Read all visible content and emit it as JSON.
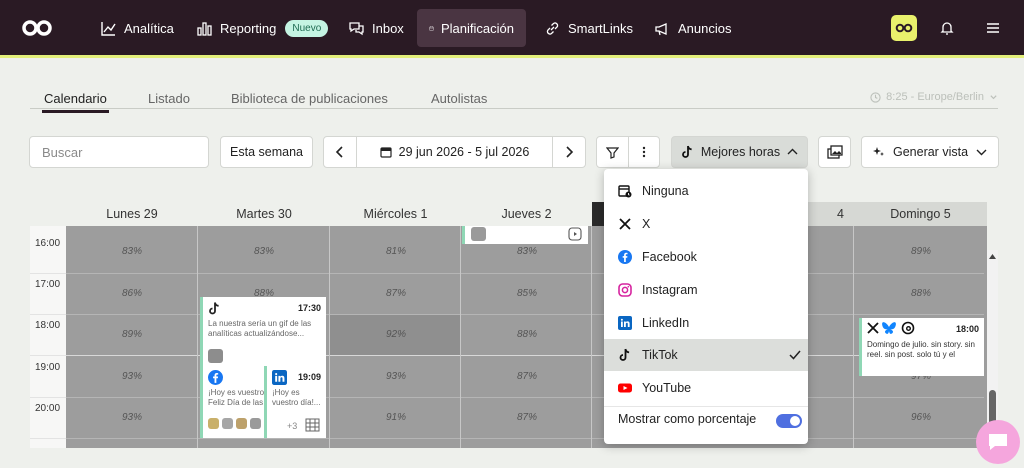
{
  "nav": {
    "items": [
      {
        "label": "Analítica",
        "icon": "chart-line-icon"
      },
      {
        "label": "Reporting",
        "icon": "bar-chart-icon",
        "badge": "Nuevo"
      },
      {
        "label": "Inbox",
        "icon": "chat-bubbles-icon"
      },
      {
        "label": "Planificación",
        "icon": "calendar-icon",
        "active": true
      },
      {
        "label": "SmartLinks",
        "icon": "link-icon"
      },
      {
        "label": "Anuncios",
        "icon": "megaphone-icon"
      }
    ],
    "brand_color": "#2a1a24",
    "accent_color": "#e3ef7a"
  },
  "tabs": {
    "items": [
      "Calendario",
      "Listado",
      "Biblioteca de publicaciones",
      "Autolistas"
    ],
    "active": "Calendario",
    "timezone": "8:25 - Europe/Berlin"
  },
  "toolbar": {
    "search_placeholder": "Buscar",
    "this_week": "Esta semana",
    "date_range": "29 jun 2026 - 5 jul 2026",
    "best_hours": "Mejores horas",
    "generate_view": "Generar vista"
  },
  "calendar": {
    "days": [
      "Lunes 29",
      "Martes 30",
      "Miércoles 1",
      "Jueves 2",
      "",
      "4",
      "Domingo 5"
    ],
    "hours": [
      "16:00",
      "17:00",
      "18:00",
      "19:00",
      "20:00"
    ],
    "percentages": {
      "lunes": [
        "83%",
        "86%",
        "89%",
        "93%",
        "93%"
      ],
      "martes": [
        "83%",
        "88%",
        "",
        "",
        ""
      ],
      "miercoles": [
        "81%",
        "87%",
        "92%",
        "93%",
        "91%"
      ],
      "jueves": [
        "83%",
        "85%",
        "88%",
        "87%",
        "87%"
      ],
      "domingo": [
        "89%",
        "88%",
        "",
        "97%",
        "96%"
      ]
    }
  },
  "posts": {
    "tiktok": {
      "time": "17:30",
      "text": "La nuestra sería un gif de las analíticas actualizándose..."
    },
    "facebook": {
      "text": "¡Hoy es vuestro Feliz Día de las"
    },
    "linkedin": {
      "time": "19:09",
      "text": "¡Hoy es vuestro día!..."
    },
    "more": "+3",
    "sunday": {
      "time": "18:00",
      "text": "Domingo de julio. sin story. sin reel. sin post. solo tú y el"
    }
  },
  "dropdown": {
    "items": [
      {
        "label": "Ninguna",
        "icon": "calendar-clock-icon"
      },
      {
        "label": "X",
        "icon": "x-icon"
      },
      {
        "label": "Facebook",
        "icon": "facebook-icon"
      },
      {
        "label": "Instagram",
        "icon": "instagram-icon"
      },
      {
        "label": "LinkedIn",
        "icon": "linkedin-icon"
      },
      {
        "label": "TikTok",
        "icon": "tiktok-icon",
        "selected": true
      },
      {
        "label": "YouTube",
        "icon": "youtube-icon"
      }
    ],
    "toggle_label": "Mostrar como porcentaje",
    "toggle_on": true
  }
}
